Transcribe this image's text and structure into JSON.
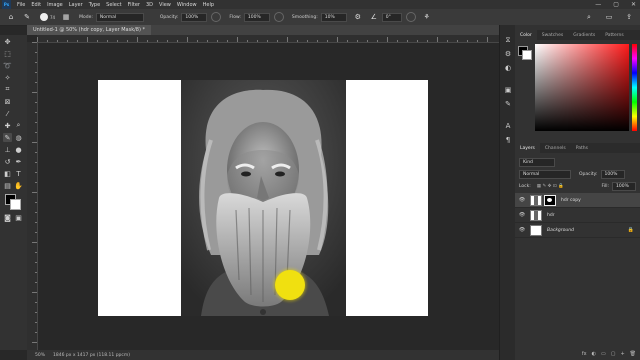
{
  "menubar": {
    "logo": "Ps",
    "items": [
      "File",
      "Edit",
      "Image",
      "Layer",
      "Type",
      "Select",
      "Filter",
      "3D",
      "View",
      "Window",
      "Help"
    ],
    "window_controls": [
      "—",
      "▢",
      "✕"
    ]
  },
  "options": {
    "brush_size": "74",
    "mode_label": "Mode:",
    "mode_value": "Normal",
    "opacity_label": "Opacity:",
    "opacity_value": "100%",
    "flow_label": "Flow:",
    "flow_value": "100%",
    "smoothing_label": "Smoothing:",
    "smoothing_value": "10%",
    "angle_value": "0°"
  },
  "document": {
    "tab_title": "Untitled-1 @ 50% (hdr copy, Layer Mask/8) *",
    "status_zoom": "50%",
    "status_info": "1846 px x 1417 px (118.11 ppcm)"
  },
  "panels": {
    "color_tabs": [
      "Color",
      "Swatches",
      "Gradients",
      "Patterns"
    ],
    "layers_tabs": [
      "Layers",
      "Channels",
      "Paths"
    ],
    "kind_label": "Kind",
    "blend_mode": "Normal",
    "opacity_label": "Opacity:",
    "opacity_value": "100%",
    "lock_label": "Lock:",
    "fill_label": "Fill:",
    "fill_value": "100%",
    "layers": [
      {
        "name": "hdr copy",
        "selected": true
      },
      {
        "name": "hdr",
        "selected": false
      },
      {
        "name": "Background",
        "selected": false
      }
    ],
    "footer_icons": [
      "fx",
      "◐",
      "▭",
      "▢",
      "+",
      "🗑"
    ]
  },
  "colors": {
    "foreground": "#000000",
    "background": "#ffffff",
    "brush_spot": "#f0e010",
    "panel_bg": "#323232"
  }
}
